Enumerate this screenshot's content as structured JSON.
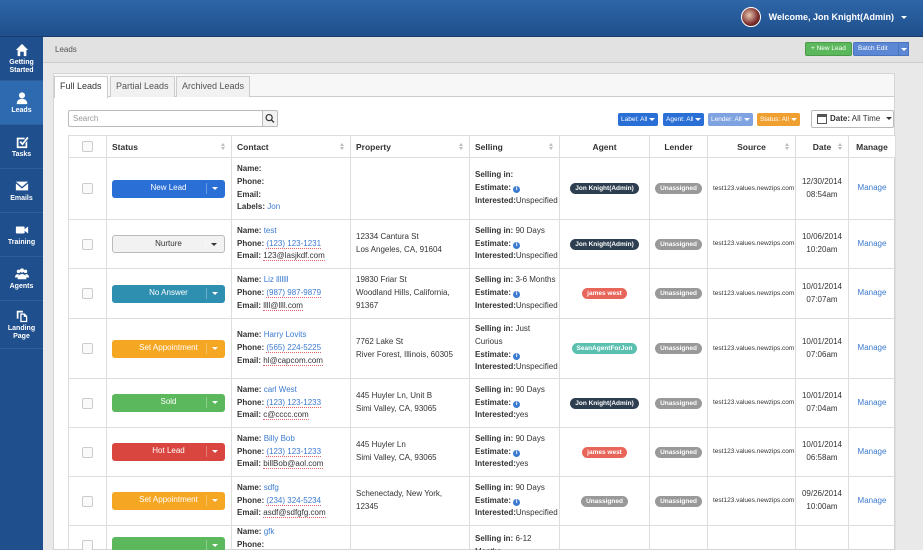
{
  "topbar": {
    "welcome": "Welcome, Jon Knight(Admin)"
  },
  "sidebar": {
    "items": [
      {
        "label": "Getting Started",
        "icon": "home-icon"
      },
      {
        "label": "Leads",
        "icon": "person-icon"
      },
      {
        "label": "Tasks",
        "icon": "checkbox-icon"
      },
      {
        "label": "Emails",
        "icon": "envelope-icon"
      },
      {
        "label": "Training",
        "icon": "video-camera-icon"
      },
      {
        "label": "Agents",
        "icon": "group-icon"
      },
      {
        "label": "Landing Page",
        "icon": "copy-icon"
      }
    ]
  },
  "header": {
    "breadcrumb": "Leads",
    "new_lead": "+ New Lead",
    "batch_edit": "Batch Edit"
  },
  "tabs": [
    "Full Leads",
    "Partial Leads",
    "Archived Leads"
  ],
  "search": {
    "placeholder": "Search"
  },
  "filters": {
    "label": "Label: All",
    "agent": "Agent: All",
    "lender": "Lender: All",
    "status": "Status: All",
    "date_label": "Date:",
    "date_value": "All Time",
    "colors": {
      "label": "#2a6fd6",
      "agent": "#2a6fd6",
      "lender": "#7fa3e0",
      "status": "#f0a030"
    }
  },
  "columns": [
    "Status",
    "Contact",
    "Property",
    "Selling",
    "Agent",
    "Lender",
    "Source",
    "Date",
    "Manage"
  ],
  "contact_labels": {
    "name": "Name:",
    "phone": "Phone:",
    "email": "Email:",
    "labels": "Labels:"
  },
  "selling_labels": {
    "selling_in": "Selling in:",
    "estimate": "Estimate:",
    "interested": "Interested:"
  },
  "rows": [
    {
      "status": "New Lead",
      "status_color": "#2a6fd6",
      "name": "",
      "phone": "",
      "email": "",
      "labels": "Jon",
      "prop1": "",
      "prop2": "",
      "prop3": "",
      "selling_in": "",
      "interested": "Unspecified",
      "agent": "Jon Knight(Admin)",
      "agent_color": "#2d3e50",
      "lender": "Unassigned",
      "source": "test123.values.newzips.com",
      "date": "12/30/2014",
      "time": "08:54am",
      "manage": "Manage"
    },
    {
      "status": "Nurture",
      "status_color": "#f2f2f2",
      "name": "test",
      "phone": "(123) 123-1231",
      "email": "123@lasjkdf.com",
      "prop1": "12334 Cantura St",
      "prop2": "Los Angeles, CA, 91604",
      "prop3": "",
      "selling_in": "90 Days",
      "interested": "Unspecified",
      "agent": "Jon Knight(Admin)",
      "agent_color": "#2d3e50",
      "lender": "Unassigned",
      "source": "test123.values.newzips.com",
      "date": "10/06/2014",
      "time": "10:20am",
      "manage": "Manage"
    },
    {
      "status": "No Answer",
      "status_color": "#2e8fb0",
      "name": "Liz lllllll",
      "phone": "(987) 987-9879",
      "email": "llll@llll.com",
      "prop1": "19830 Friar St",
      "prop2": "Woodland Hills, California,",
      "prop3": "91367",
      "selling_in": "3-6 Months",
      "interested": "Unspecified",
      "agent": "james west",
      "agent_color": "#e8655a",
      "lender": "Unassigned",
      "source": "test123.values.newzips.com",
      "date": "10/01/2014",
      "time": "07:07am",
      "manage": "Manage"
    },
    {
      "status": "Set Appointment",
      "status_color": "#f5a623",
      "name": "Harry Lovits",
      "phone": "(565) 224-5225",
      "email": "hl@capcom.com",
      "prop1": "7762 Lake St",
      "prop2": "River Forest, Illinois, 60305",
      "prop3": "",
      "selling_in": "Just Curious",
      "interested": "Unspecified",
      "agent": "SeanAgentForJon",
      "agent_color": "#5bc0b0",
      "lender": "Unassigned",
      "source": "test123.values.newzips.com",
      "date": "10/01/2014",
      "time": "07:06am",
      "manage": "Manage"
    },
    {
      "status": "Sold",
      "status_color": "#5cb85c",
      "name": "carl West",
      "phone": "(123) 123-1233",
      "email": "c@cccc.com",
      "prop1": "445 Huyler Ln, Unit B",
      "prop2": "Simi Valley, CA, 93065",
      "prop3": "",
      "selling_in": "90 Days",
      "interested": "yes",
      "agent": "Jon Knight(Admin)",
      "agent_color": "#2d3e50",
      "lender": "Unassigned",
      "source": "test123.values.newzips.com",
      "date": "10/01/2014",
      "time": "07:04am",
      "manage": "Manage"
    },
    {
      "status": "Hot Lead",
      "status_color": "#d9453f",
      "name": "Billy Bob",
      "phone": "(123) 123-1233",
      "email": "billBob@aol.com",
      "prop1": "445 Huyler Ln",
      "prop2": "Simi Valley, CA, 93065",
      "prop3": "",
      "selling_in": "90 Days",
      "interested": "yes",
      "agent": "james west",
      "agent_color": "#e8655a",
      "lender": "Unassigned",
      "source": "test123.values.newzips.com",
      "date": "10/01/2014",
      "time": "06:58am",
      "manage": "Manage"
    },
    {
      "status": "Set Appointment",
      "status_color": "#f5a623",
      "name": "sdfg",
      "phone": "(234) 324-5234",
      "email": "asdf@sdfgfg.com",
      "prop1": "Schenectady, New York,",
      "prop2": "12345",
      "prop3": "",
      "selling_in": "90 Days",
      "interested": "Unspecified",
      "agent": "Unassigned",
      "agent_color": "#999999",
      "lender": "Unassigned",
      "source": "test123.values.newzips.com",
      "date": "09/26/2014",
      "time": "10:00am",
      "manage": "Manage"
    },
    {
      "status": "",
      "status_color": "#5cb85c",
      "name": "gfk",
      "phone": "",
      "email": "",
      "prop1": "",
      "prop2": "",
      "prop3": "",
      "selling_in": "6-12",
      "selling_in_2": "Months",
      "interested": "",
      "agent": "",
      "agent_color": "#999999",
      "lender": "",
      "source": "",
      "date": "",
      "time": "",
      "manage": ""
    }
  ]
}
